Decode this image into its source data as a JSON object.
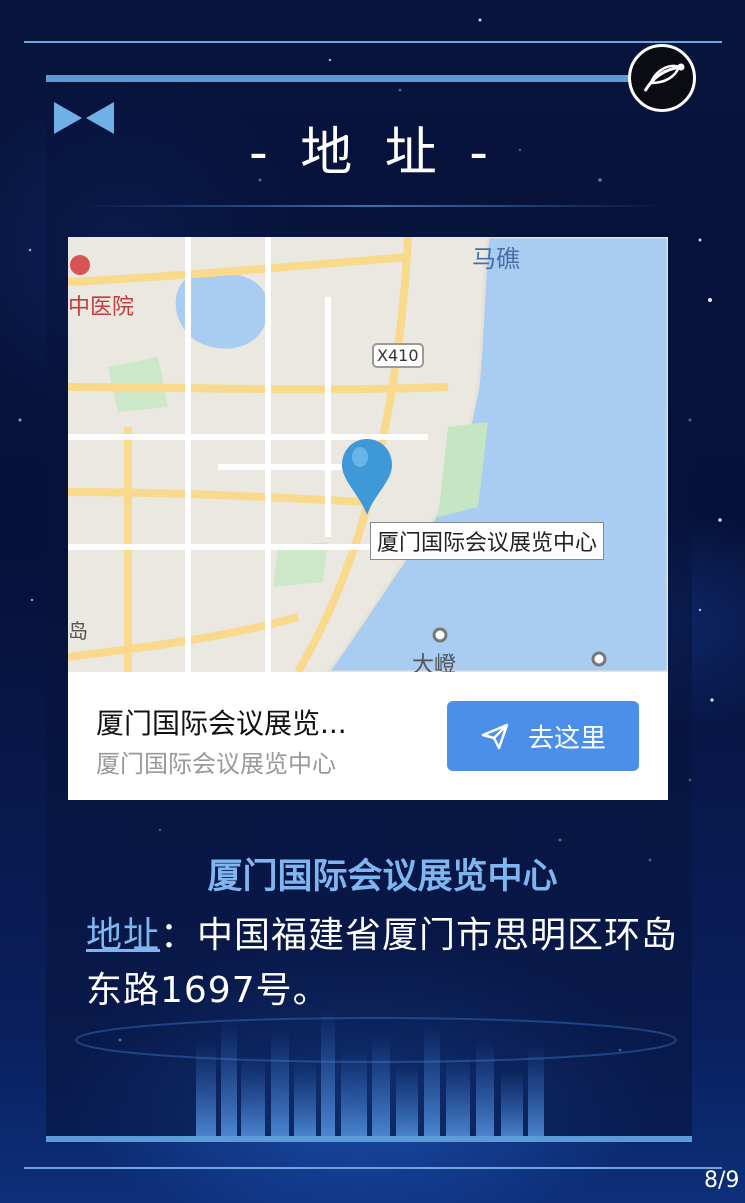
{
  "title": "- 地 址 -",
  "map": {
    "labels": {
      "majiao": "马礁",
      "hospital": "中医院",
      "road_badge": "X410",
      "poi": "厦门国际会议展览中心",
      "dakeng": "大嶝",
      "edge": "岛"
    }
  },
  "location_card": {
    "name": "厦门国际会议展览...",
    "subtitle": "厦门国际会议展览中心",
    "go_button": "去这里"
  },
  "venue_name": "厦门国际会议展览中心",
  "address": {
    "link_label": "地址",
    "separator": "：",
    "text": "中国福建省厦门市思明区环岛东路1697号。"
  },
  "page_indicator": "8/9",
  "colors": {
    "accent": "#4c8fe9",
    "highlight_text": "#7fb6f0",
    "frame_bar": "#5b9bd8",
    "background": "#06113a"
  },
  "icons": {
    "share": "share-icon",
    "decoration": "bowtie-icon",
    "navigate": "navigate-arrow-icon",
    "map_pin": "map-pin-icon"
  }
}
